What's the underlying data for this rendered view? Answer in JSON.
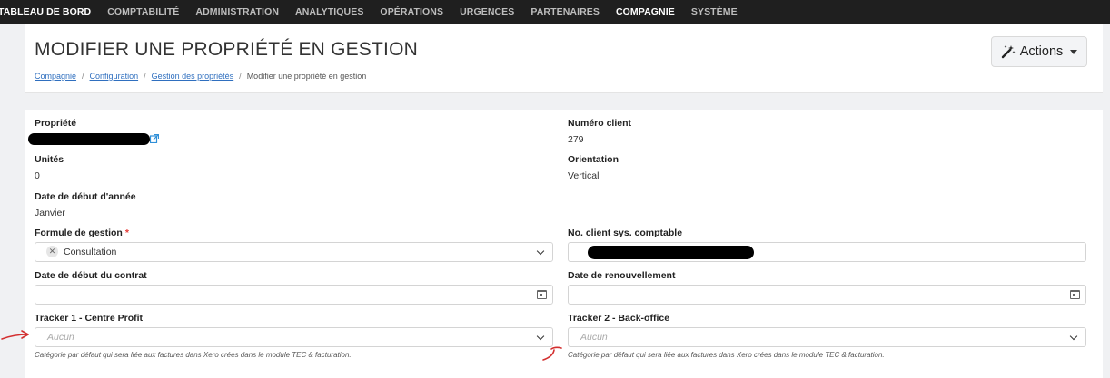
{
  "nav": {
    "items": [
      "TABLEAU DE BORD",
      "COMPTABILITÉ",
      "ADMINISTRATION",
      "ANALYTIQUES",
      "OPÉRATIONS",
      "URGENCES",
      "PARTENAIRES",
      "COMPAGNIE",
      "SYSTÈME"
    ],
    "active": "COMPAGNIE"
  },
  "header": {
    "title": "MODIFIER UNE PROPRIÉTÉ EN GESTION",
    "actions_label": "Actions",
    "actions_icon": "magic-wand-icon",
    "breadcrumb": {
      "items": [
        "Compagnie",
        "Configuration",
        "Gestion des propriétés"
      ],
      "current": "Modifier une propriété en gestion",
      "separator": "/"
    }
  },
  "form": {
    "propriete_label": "Propriété",
    "numero_client_label": "Numéro client",
    "numero_client_value": "279",
    "unites_label": "Unités",
    "unites_value": "0",
    "orientation_label": "Orientation",
    "orientation_value": "Vertical",
    "debut_annee_label": "Date de début d'année",
    "debut_annee_value": "Janvier",
    "formule_label": "Formule de gestion",
    "formule_required_mark": "*",
    "formule_value": "Consultation",
    "no_client_sys_label": "No. client sys. comptable",
    "debut_contrat_label": "Date de début du contrat",
    "renouvellement_label": "Date de renouvellement",
    "tracker1_label": "Tracker 1 - Centre Profit",
    "tracker1_placeholder": "Aucun",
    "tracker1_help": "Catégorie par défaut qui sera liée aux factures dans Xero crées dans le module TEC & facturation.",
    "tracker2_label": "Tracker 2 - Back-office",
    "tracker2_placeholder": "Aucun",
    "tracker2_help": "Catégorie par défaut qui sera liée aux factures dans Xero crées dans le module TEC & facturation."
  },
  "colors": {
    "nav_bg": "#1f1f1f",
    "link": "#2f6fbf",
    "required": "#e53935",
    "annotation": "#d32f2f"
  }
}
